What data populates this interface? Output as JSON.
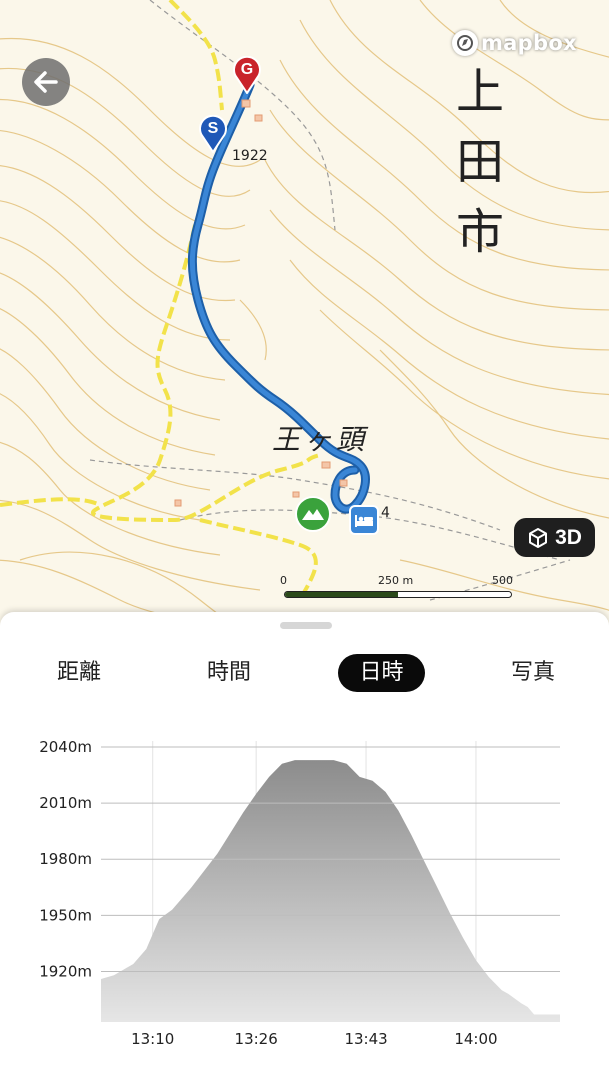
{
  "map": {
    "provider": "mapbox",
    "place_label": "上 田 市",
    "peak_label": "王ヶ頭",
    "spot_elevation": "1922",
    "spot_elevation_2": "4",
    "markers": {
      "goal": "G",
      "start": "S"
    },
    "button_3d": "3D",
    "scale": {
      "zero": "0",
      "mid": "250 m",
      "end": "500 m"
    },
    "colors": {
      "route": "#3a86d6",
      "goal": "#c9232a",
      "start": "#1f58b7",
      "trail": "#f2e24a",
      "contour": "#e6c88a"
    }
  },
  "tabs": [
    {
      "label": "距離",
      "active": false
    },
    {
      "label": "時間",
      "active": false
    },
    {
      "label": "日時",
      "active": true
    },
    {
      "label": "写真",
      "active": false
    }
  ],
  "chart_data": {
    "type": "area",
    "title": "",
    "xlabel": "",
    "ylabel": "",
    "y_tick_labels": [
      "2040m",
      "2010m",
      "1980m",
      "1950m",
      "1920m"
    ],
    "y_ticks": [
      2040,
      2010,
      1980,
      1950,
      1920
    ],
    "x_tick_labels": [
      "13:10",
      "13:26",
      "13:43",
      "14:00"
    ],
    "ylim": [
      1893,
      2040
    ],
    "xlim": [
      "13:02",
      "14:13"
    ],
    "fill_color": "#8c8c8c",
    "series": [
      {
        "x": [
          "13:02",
          "13:04",
          "13:07",
          "13:09",
          "13:10",
          "13:11",
          "13:13",
          "13:14",
          "13:16",
          "13:18",
          "13:20",
          "13:22",
          "13:24",
          "13:26",
          "13:28",
          "13:30",
          "13:32",
          "13:34",
          "13:36",
          "13:38",
          "13:40",
          "13:42",
          "13:44",
          "13:46",
          "13:48",
          "13:50",
          "13:52",
          "13:54",
          "13:56",
          "13:58",
          "14:00",
          "14:02",
          "14:04",
          "14:05",
          "14:07",
          "14:08",
          "14:09",
          "14:13"
        ],
        "y": [
          1916,
          1918,
          1924,
          1932,
          1940,
          1948,
          1953,
          1957,
          1965,
          1974,
          1983,
          1994,
          2005,
          2015,
          2024,
          2031,
          2033,
          2033,
          2033,
          2033,
          2031,
          2024,
          2022,
          2016,
          2006,
          1993,
          1979,
          1965,
          1951,
          1938,
          1926,
          1917,
          1910,
          1908,
          1903,
          1901,
          1897,
          1897
        ]
      }
    ]
  }
}
